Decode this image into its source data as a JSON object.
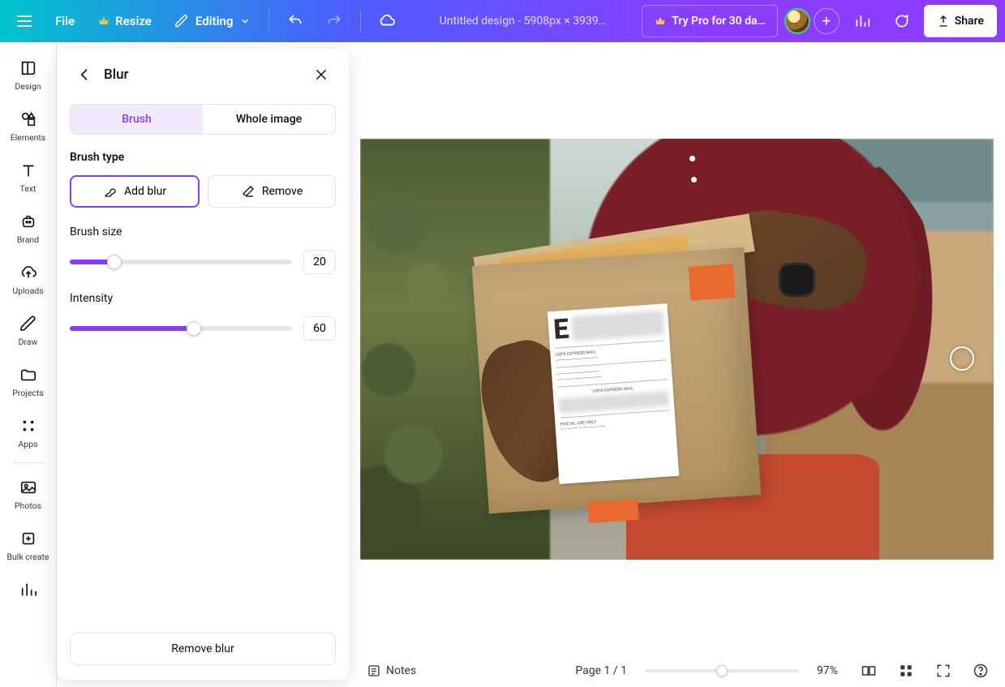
{
  "topbar": {
    "file": "File",
    "resize": "Resize",
    "editing": "Editing",
    "title": "Untitled design - 5908px × 3939…",
    "try_pro": "Try Pro for 30 da…",
    "share": "Share"
  },
  "sidebar": {
    "items": [
      {
        "label": "Design"
      },
      {
        "label": "Elements"
      },
      {
        "label": "Text"
      },
      {
        "label": "Brand"
      },
      {
        "label": "Uploads"
      },
      {
        "label": "Draw"
      },
      {
        "label": "Projects"
      },
      {
        "label": "Apps"
      },
      {
        "label": "Photos"
      },
      {
        "label": "Bulk create"
      }
    ]
  },
  "panel": {
    "title": "Blur",
    "tab_brush": "Brush",
    "tab_whole": "Whole image",
    "brush_type_label": "Brush type",
    "add_blur": "Add blur",
    "remove": "Remove",
    "brush_size_label": "Brush size",
    "brush_size_value": "20",
    "brush_size_pct": 20,
    "intensity_label": "Intensity",
    "intensity_value": "60",
    "intensity_pct": 56,
    "remove_blur": "Remove blur"
  },
  "label": {
    "bigE": "E",
    "usps1": "USPS EXPRESS MAIL",
    "usps2": "USPS EXPRESS MAIL",
    "postal": "POSTAL USE ONLY"
  },
  "bottom": {
    "notes": "Notes",
    "page": "Page 1 / 1",
    "zoom": "97%"
  }
}
